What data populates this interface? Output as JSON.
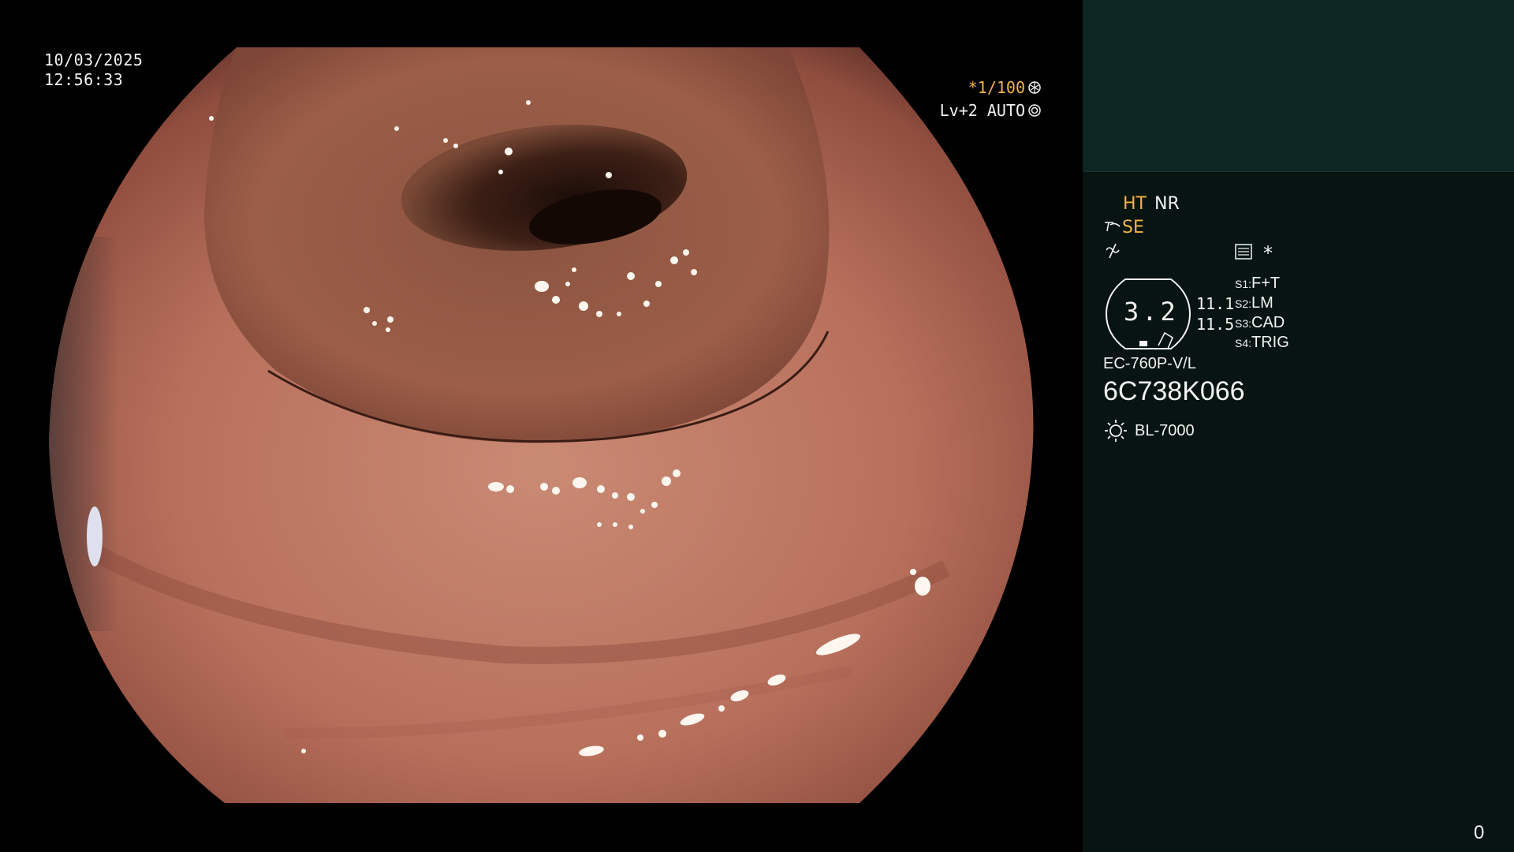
{
  "overlay": {
    "date": "10/03/2025",
    "time": "12:56:33",
    "shutter": "*1/100",
    "iris": "Lv+2 AUTO"
  },
  "panel": {
    "ht": "HT",
    "nr": "NR",
    "se": "SE",
    "star": "*",
    "zoom": "3.2",
    "value_a": "11.1",
    "value_b": "11.5",
    "s_settings": [
      {
        "key": "S1:",
        "value": "F+T"
      },
      {
        "key": "S2:",
        "value": "LM"
      },
      {
        "key": "S3:",
        "value": "CAD"
      },
      {
        "key": "S4:",
        "value": "TRIG"
      }
    ],
    "scope_model": "EC-760P-V/L",
    "scope_serial": "6C738K066",
    "light_source": "BL-7000",
    "counter": "0"
  },
  "icons": {
    "shutter": "aperture-icon",
    "iris": "iris-icon",
    "se": "structure-enhance-icon",
    "nf": "noise-filter-icon",
    "menu": "menu-list-icon",
    "light": "sun-icon"
  },
  "colors": {
    "accent": "#f2b446",
    "panel_bg": "#071412",
    "panel_top_bg": "#0d2624",
    "text": "#f2f2f2"
  }
}
